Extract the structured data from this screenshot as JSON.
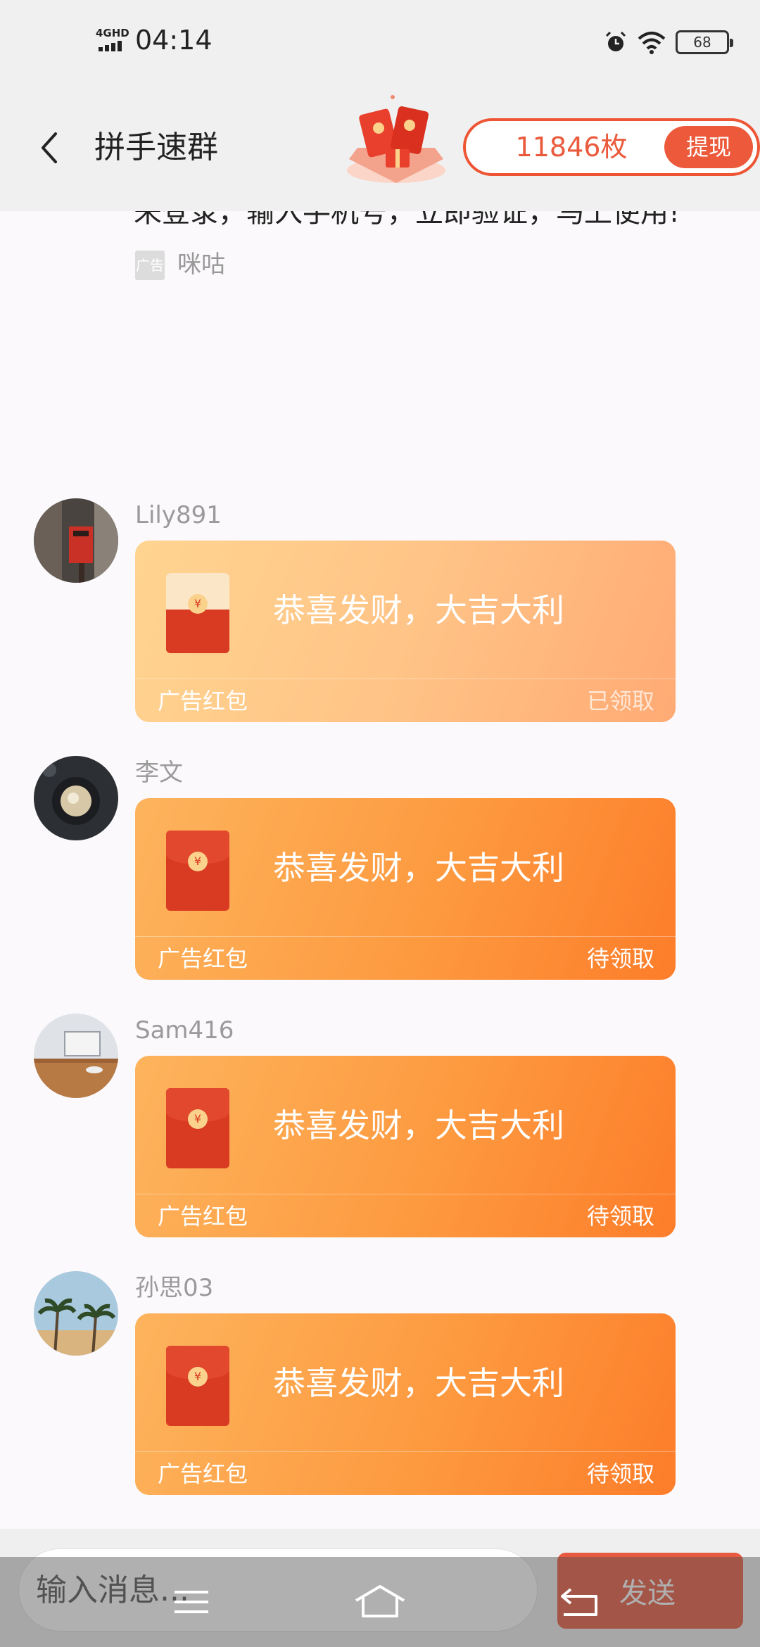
{
  "status_bar": {
    "network": "4GHD",
    "time": "04:14",
    "battery": "68"
  },
  "header": {
    "title": "拼手速群",
    "coin_count": "11846枚",
    "withdraw_label": "提现"
  },
  "previous_message": {
    "text": "未登录，输入手机号，立即验证，马上使用!",
    "badge": "广告",
    "source": "咪咕"
  },
  "messages": [
    {
      "sender": "Lily891",
      "greeting": "恭喜发财，大吉大利",
      "type_label": "广告红包",
      "status": "已领取",
      "opened": true
    },
    {
      "sender": "李文",
      "greeting": "恭喜发财，大吉大利",
      "type_label": "广告红包",
      "status": "待领取",
      "opened": false
    },
    {
      "sender": "Sam416",
      "greeting": "恭喜发财，大吉大利",
      "type_label": "广告红包",
      "status": "待领取",
      "opened": false
    },
    {
      "sender": "孙思03",
      "greeting": "恭喜发财，大吉大利",
      "type_label": "广告红包",
      "status": "待领取",
      "opened": false
    }
  ],
  "composer": {
    "placeholder": "输入消息...",
    "send_label": "发送"
  },
  "icons": {
    "back": "chevron-left-icon",
    "alarm": "alarm-icon",
    "wifi": "wifi-icon",
    "battery": "battery-icon",
    "red_envelope": "red-envelope-icon"
  },
  "colors": {
    "accent": "#ec5a3b",
    "packet_pending": "#fd9a40",
    "packet_opened": "#ffc487",
    "envelope": "#d93a22"
  }
}
